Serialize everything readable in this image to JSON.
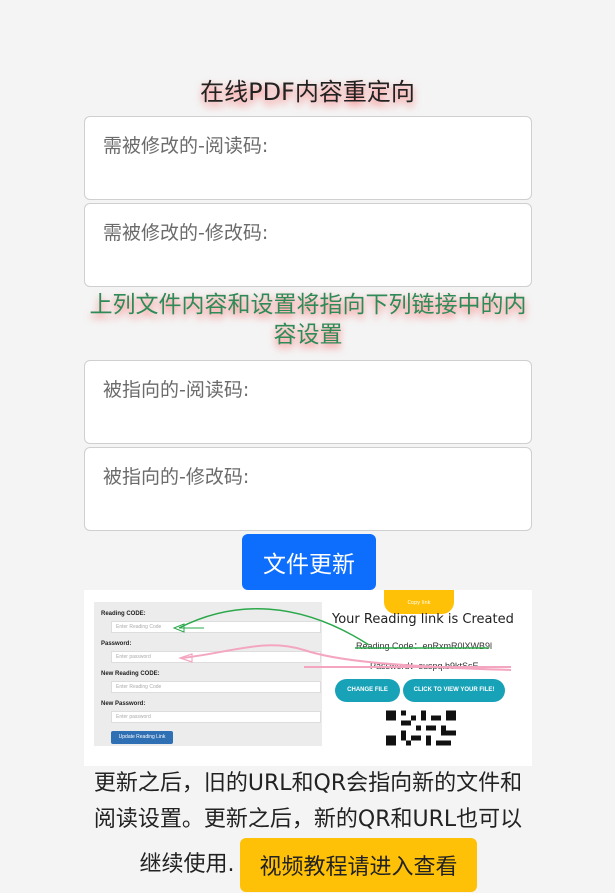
{
  "header": {
    "title": "在线PDF内容重定向"
  },
  "fields": {
    "old_read": {
      "placeholder": "需被修改的-阅读码:"
    },
    "old_edit": {
      "placeholder": "需被修改的-修改码:"
    },
    "new_read": {
      "placeholder": "被指向的-阅读码:"
    },
    "new_edit": {
      "placeholder": "被指向的-修改码:"
    }
  },
  "note": "上列文件内容和设置将指向下列链接中的内容设置",
  "update_button": "文件更新",
  "illustration": {
    "reading_code_label": "Reading CODE:",
    "reading_code_placeholder": "Enter Reading Code",
    "password_label": "Password:",
    "password_placeholder": "Enter password",
    "new_reading_code_label": "New Reading CODE:",
    "new_reading_code_placeholder": "Enter Reading Code",
    "new_password_label": "New Password:",
    "new_password_placeholder": "Enter password",
    "update_link_button": "Update Reading Link",
    "created_title": "Your Reading link is Created",
    "reading_code_line": "Reading Code：enRxmR0lXWB9l",
    "password_line": "Password：suspq.b9ktSsE",
    "change_file_button": "CHANGE FILE",
    "view_file_button": "CLICK TO VIEW YOUR FILE!",
    "copy_button": "Copy link"
  },
  "bottom": {
    "text": "更新之后，旧的URL和QR会指向新的文件和阅读设置。更新之后，新的QR和URL也可以继续使用.",
    "video_button": "视频教程请进入查看"
  },
  "colors": {
    "primary": "#0d6efd",
    "warning": "#ffc107",
    "note_green": "#2e8b57",
    "teal": "#17a2b8"
  }
}
